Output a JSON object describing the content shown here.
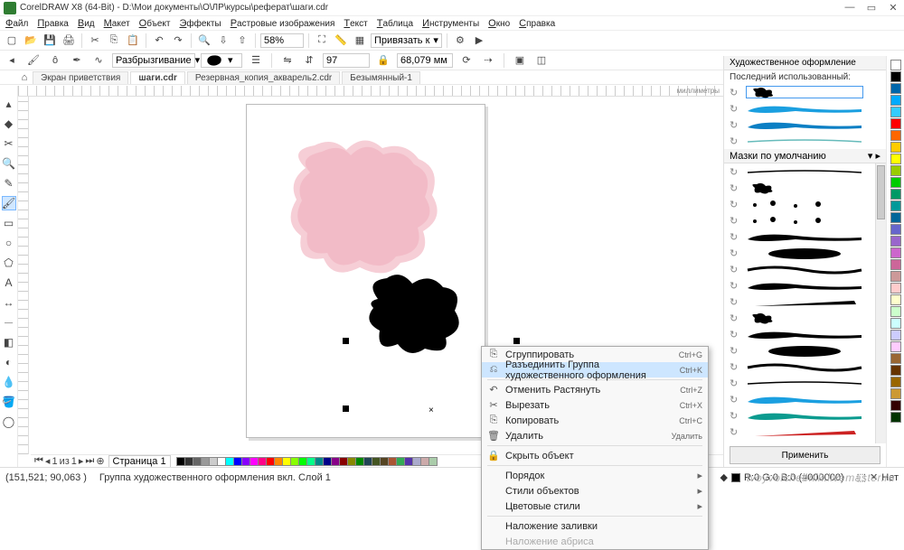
{
  "title": "CorelDRAW X8 (64-Bit) - D:\\Мои документы\\O\\ЛР\\курсы\\реферат\\шаги.cdr",
  "menu": [
    "Файл",
    "Правка",
    "Вид",
    "Макет",
    "Объект",
    "Эффекты",
    "Растровые изображения",
    "Текст",
    "Таблица",
    "Инструменты",
    "Окно",
    "Справка"
  ],
  "zoom": "58%",
  "snap_label": "Привязать к",
  "prop_style": "Разбрызгивание",
  "prop_num1": "97",
  "prop_num2": "68,079 мм",
  "tabs": [
    "Экран приветствия",
    "шаги.cdr",
    "Резервная_копия_акварель2.cdr",
    "Безымянный-1"
  ],
  "active_tab": 1,
  "ruler_unit": "миллиметры",
  "ctx": [
    {
      "ic": "⎘",
      "lbl": "Сгруппировать",
      "sc": "Ctrl+G"
    },
    {
      "ic": "⎌",
      "lbl": "Разъединить Группа художественного оформления",
      "sc": "Ctrl+K",
      "hl": true
    },
    {
      "sep": true
    },
    {
      "ic": "↶",
      "lbl": "Отменить Растянуть",
      "sc": "Ctrl+Z"
    },
    {
      "ic": "✂",
      "lbl": "Вырезать",
      "sc": "Ctrl+X"
    },
    {
      "ic": "⎘",
      "lbl": "Копировать",
      "sc": "Ctrl+C"
    },
    {
      "ic": "🗑",
      "lbl": "Удалить",
      "sc": "Удалить"
    },
    {
      "sep": true
    },
    {
      "ic": "🔒",
      "lbl": "Скрыть объект"
    },
    {
      "sep": true
    },
    {
      "lbl": "Порядок",
      "arr": true
    },
    {
      "lbl": "Стили объектов",
      "arr": true
    },
    {
      "lbl": "Цветовые стили",
      "arr": true
    },
    {
      "sep": true
    },
    {
      "lbl": "Наложение заливки"
    },
    {
      "lbl": "Наложение абриса",
      "dis": true
    }
  ],
  "panel_title": "Художественное оформление",
  "panel_last": "Последний использованный:",
  "panel_default": "Мазки по умолчанию",
  "apply": "Применить",
  "pager": {
    "page": "1",
    "of": "из",
    "total": "1",
    "tab": "Страница 1"
  },
  "status_coords": "(151,521; 90,063 )",
  "status_sel": "Группа художественного оформления вкл. Слой 1",
  "status_fill_a": "R:0 G:0 B:0 (#000000)",
  "status_fill_b": "Нет",
  "watermark": "tvoyvolchebnik.livemaster.ru",
  "palette_colors": [
    "#000",
    "#333",
    "#666",
    "#999",
    "#ccc",
    "#fff",
    "#0ff",
    "#00f",
    "#80f",
    "#f0f",
    "#f08",
    "#f00",
    "#f80",
    "#ff0",
    "#8f0",
    "#0f0",
    "#0f8",
    "#088",
    "#008",
    "#808",
    "#800",
    "#880",
    "#080",
    "#245",
    "#452",
    "#542",
    "#a53",
    "#3a5",
    "#53a",
    "#aac",
    "#caa",
    "#aca"
  ],
  "right_colors": [
    "#fff",
    "#000",
    "#06a",
    "#0af",
    "#3cf",
    "#f00",
    "#f60",
    "#fc0",
    "#ff0",
    "#9c0",
    "#0c0",
    "#096",
    "#099",
    "#069",
    "#66c",
    "#96c",
    "#c6c",
    "#c69",
    "#c99",
    "#fcc",
    "#ffc",
    "#cfc",
    "#cff",
    "#ccf",
    "#fcf",
    "#963",
    "#630",
    "#960",
    "#c93",
    "#300",
    "#030"
  ]
}
